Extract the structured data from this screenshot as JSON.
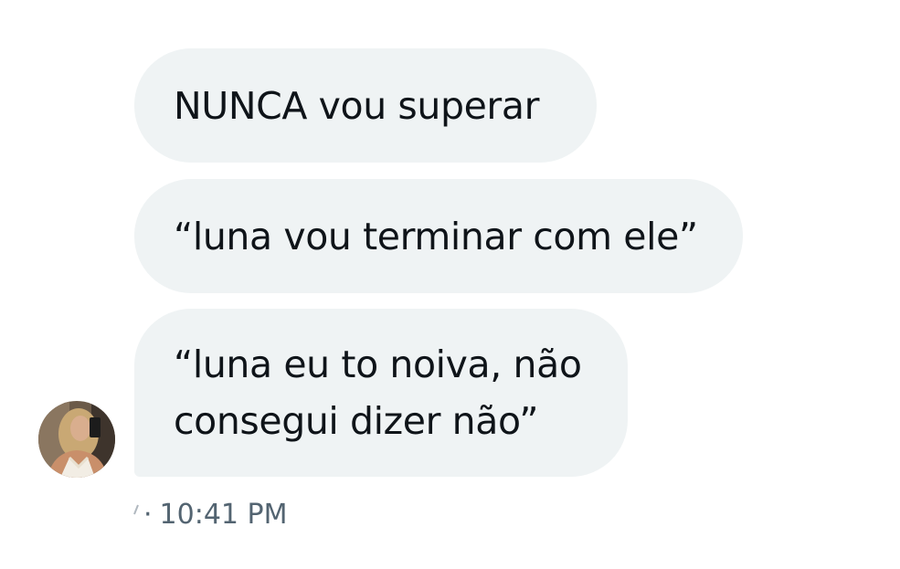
{
  "conversation": {
    "messages": [
      {
        "lines": [
          "NUNCA vou superar"
        ]
      },
      {
        "lines": [
          "“luna vou terminar com ele”"
        ]
      },
      {
        "lines": [
          "“luna eu to noiva, não",
          "consegui dizer não”"
        ]
      }
    ],
    "timestamp": "10:41 PM",
    "separator": "·",
    "sender_avatar_icon": "user-avatar-photo",
    "status_icon": "sent-status-icon"
  }
}
